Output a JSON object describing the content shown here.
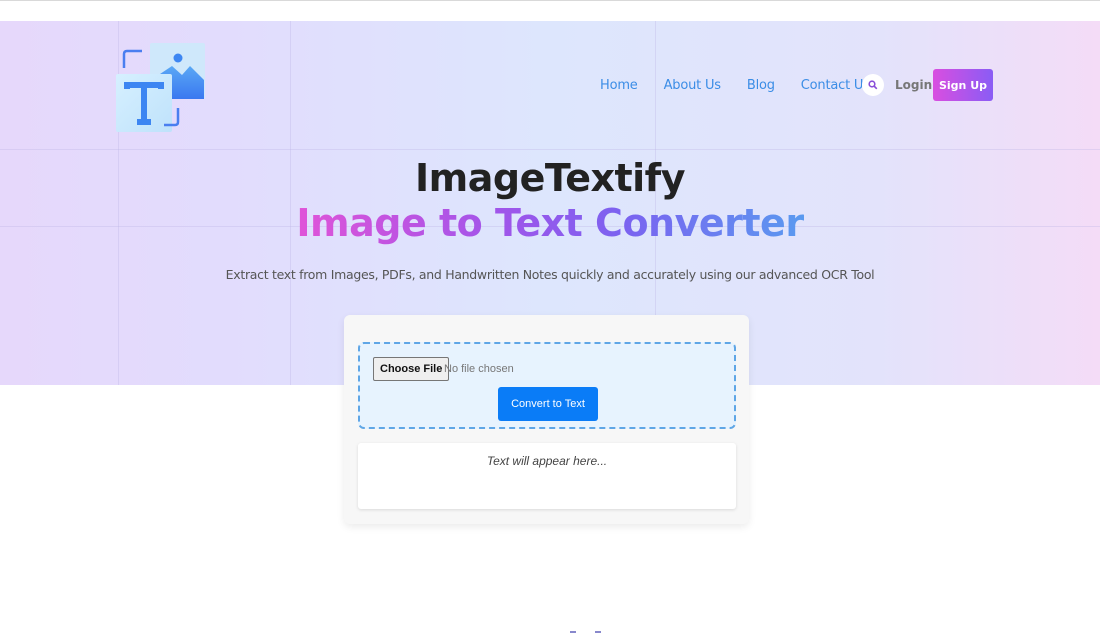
{
  "brand": {
    "name": "ImageTextify",
    "logo_icon": "image-text-logo-icon"
  },
  "nav": {
    "links": [
      {
        "label": "Home"
      },
      {
        "label": "About Us"
      },
      {
        "label": "Blog"
      },
      {
        "label": "Contact Us"
      }
    ],
    "search_icon": "search-icon",
    "login_label": "Login",
    "signup_label": "Sign Up"
  },
  "hero": {
    "title": "ImageTextify",
    "subtitle": "Image to Text Converter",
    "description": "Extract text from Images, PDFs, and Handwritten Notes quickly and accurately using our advanced OCR Tool"
  },
  "converter": {
    "choose_file_label": "Choose File",
    "file_status": "No file chosen",
    "convert_label": "Convert to Text",
    "output_placeholder": "Text will appear here..."
  },
  "colors": {
    "nav_link": "#3b8de6",
    "signup_gradient_start": "#d94ee0",
    "signup_gradient_end": "#8a5cf5",
    "convert_button": "#0a7cf7",
    "dropzone_border": "#5fa6e6"
  }
}
